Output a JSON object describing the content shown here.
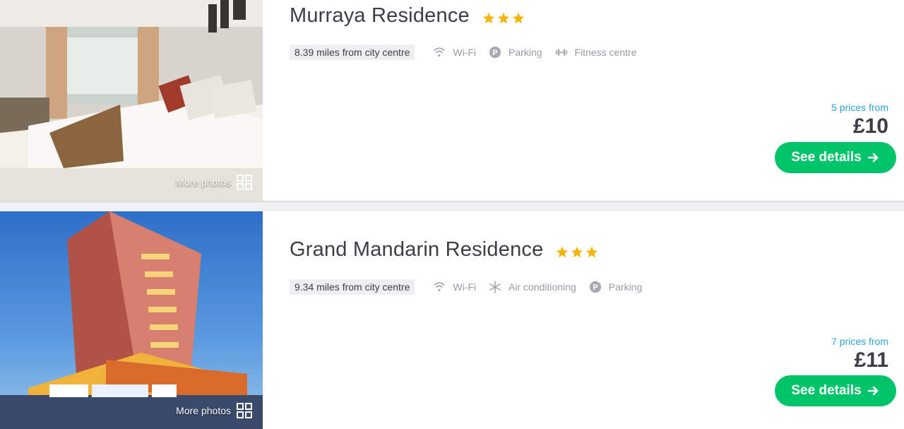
{
  "listings": [
    {
      "name": "Murraya Residence",
      "stars": 3,
      "distance": "8.39 miles from city centre",
      "amenities": [
        {
          "icon": "wifi-icon",
          "label": "Wi-Fi"
        },
        {
          "icon": "parking-icon",
          "label": "Parking"
        },
        {
          "icon": "dumbbell-icon",
          "label": "Fitness centre"
        }
      ],
      "prices_from": "5 prices from",
      "price": "£10",
      "cta_label": "See details",
      "more_photos": "More photos"
    },
    {
      "name": "Grand Mandarin Residence",
      "stars": 3,
      "distance": "9.34 miles from city centre",
      "amenities": [
        {
          "icon": "wifi-icon",
          "label": "Wi-Fi"
        },
        {
          "icon": "snowflake-icon",
          "label": "Air conditioning"
        },
        {
          "icon": "parking-icon",
          "label": "Parking"
        }
      ],
      "prices_from": "7 prices from",
      "price": "£11",
      "cta_label": "See details",
      "more_photos": "More photos"
    }
  ],
  "colors": {
    "accent_green": "#00c46a",
    "link_blue": "#2aa6d8",
    "star_yellow": "#f5b400",
    "muted_gray": "#9a9aa6"
  }
}
